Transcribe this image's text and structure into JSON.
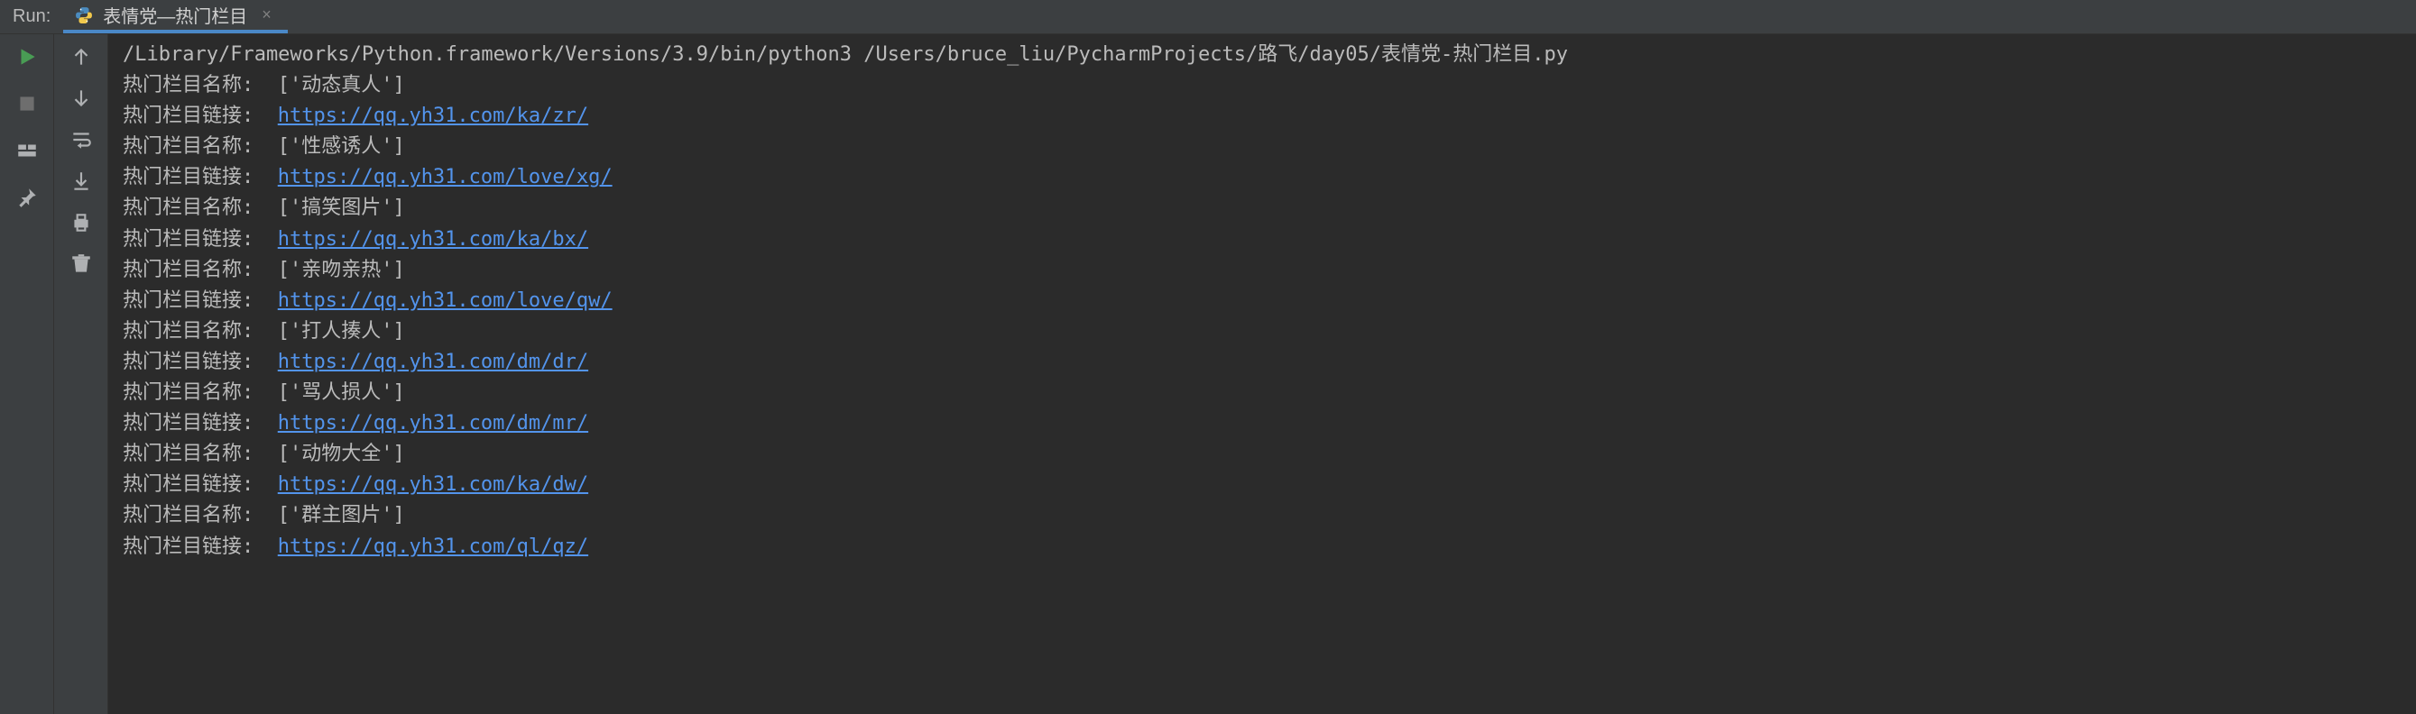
{
  "header": {
    "run_label": "Run:",
    "tab_name": "表情党—热门栏目",
    "close_glyph": "×"
  },
  "console": {
    "command": "/Library/Frameworks/Python.framework/Versions/3.9/bin/python3 /Users/bruce_liu/PycharmProjects/路飞/day05/表情党-热门栏目.py",
    "name_label_prefix": "热门栏目名称:  ",
    "link_label_prefix": "热门栏目链接:  ",
    "items": [
      {
        "name": "['动态真人']",
        "url": "https://qq.yh31.com/ka/zr/"
      },
      {
        "name": "['性感诱人']",
        "url": "https://qq.yh31.com/love/xg/"
      },
      {
        "name": "['搞笑图片']",
        "url": "https://qq.yh31.com/ka/bx/"
      },
      {
        "name": "['亲吻亲热']",
        "url": "https://qq.yh31.com/love/qw/"
      },
      {
        "name": "['打人揍人']",
        "url": "https://qq.yh31.com/dm/dr/"
      },
      {
        "name": "['骂人损人']",
        "url": "https://qq.yh31.com/dm/mr/"
      },
      {
        "name": "['动物大全']",
        "url": "https://qq.yh31.com/ka/dw/"
      },
      {
        "name": "['群主图片']",
        "url": "https://qq.yh31.com/ql/qz/"
      }
    ]
  }
}
